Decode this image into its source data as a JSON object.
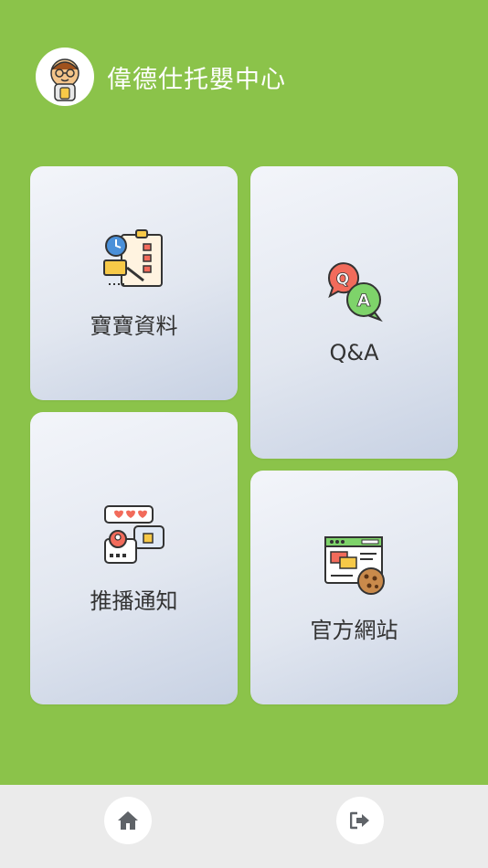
{
  "header": {
    "title": "偉德仕托嬰中心",
    "avatar_icon": "baby-avatar-icon"
  },
  "cards": [
    {
      "label": "寶寶資料",
      "icon": "baby-records-icon"
    },
    {
      "label": "Q&A",
      "icon": "qa-bubbles-icon"
    },
    {
      "label": "推播通知",
      "icon": "push-notification-icon"
    },
    {
      "label": "官方網站",
      "icon": "website-icon"
    }
  ],
  "bottom_nav": {
    "home_icon": "home-icon",
    "logout_icon": "logout-icon"
  },
  "colors": {
    "background": "#8bc34a",
    "bottom_bar": "#ebebeb",
    "card_text": "#333333"
  }
}
